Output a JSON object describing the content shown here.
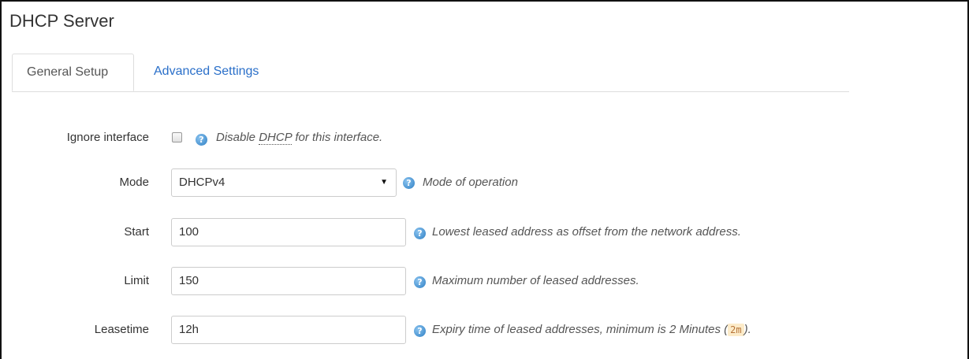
{
  "page": {
    "title": "DHCP Server"
  },
  "tabs": [
    {
      "label": "General Setup",
      "active": true
    },
    {
      "label": "Advanced Settings",
      "active": false
    }
  ],
  "form": {
    "ignore_interface": {
      "label": "Ignore interface",
      "checked": false,
      "help_prefix": "Disable ",
      "help_abbr": "DHCP",
      "help_suffix": " for this interface."
    },
    "mode": {
      "label": "Mode",
      "value": "DHCPv4",
      "help": "Mode of operation"
    },
    "start": {
      "label": "Start",
      "value": "100",
      "help": "Lowest leased address as offset from the network address."
    },
    "limit": {
      "label": "Limit",
      "value": "150",
      "help": "Maximum number of leased addresses."
    },
    "leasetime": {
      "label": "Leasetime",
      "value": "12h",
      "help_prefix": "Expiry time of leased addresses, minimum is 2 Minutes (",
      "help_code": "2m",
      "help_suffix": ")."
    }
  },
  "colors": {
    "link": "#2a6fc9",
    "help_icon": "#2e7fc4",
    "code_bg": "#fcebc9"
  },
  "icons": {
    "help": "help-icon",
    "dropdown": "chevron-down-icon"
  }
}
